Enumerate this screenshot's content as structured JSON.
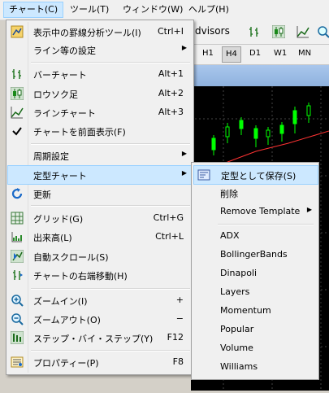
{
  "menubar": {
    "items": [
      {
        "label": "チャート(C)"
      },
      {
        "label": "ツール(T)"
      },
      {
        "label": "ウィンドウ(W)"
      },
      {
        "label": "ヘルプ(H)"
      }
    ]
  },
  "background": {
    "toolbar_text": "dvisors",
    "periods": [
      "H1",
      "H4",
      "D1",
      "W1",
      "MN"
    ]
  },
  "menu": {
    "items": [
      {
        "label": "表示中の罫線分析ツール(I)",
        "shortcut": "Ctrl+I",
        "icon": "objects-list-icon"
      },
      {
        "label": "ライン等の設定",
        "arrow": "▶"
      },
      {
        "label": "バーチャート",
        "shortcut": "Alt+1",
        "icon": "bar-chart-icon"
      },
      {
        "label": "ロウソク足",
        "shortcut": "Alt+2",
        "icon": "candlestick-icon"
      },
      {
        "label": "ラインチャート",
        "shortcut": "Alt+3",
        "icon": "line-chart-icon"
      },
      {
        "label": "チャートを前面表示(F)",
        "icon": "checkmark-icon"
      },
      {
        "label": "周期設定",
        "arrow": "▶"
      },
      {
        "label": "定型チャート",
        "arrow": "▶"
      },
      {
        "label": "更新",
        "icon": "refresh-icon"
      },
      {
        "label": "グリッド(G)",
        "shortcut": "Ctrl+G",
        "icon": "grid-icon"
      },
      {
        "label": "出来高(L)",
        "shortcut": "Ctrl+L",
        "icon": "volume-icon"
      },
      {
        "label": "自動スクロール(S)",
        "icon": "auto-scroll-icon"
      },
      {
        "label": "チャートの右端移動(H)",
        "icon": "chart-shift-icon"
      },
      {
        "label": "ズームイン(I)",
        "shortcut": "+",
        "icon": "zoom-in-icon"
      },
      {
        "label": "ズームアウト(O)",
        "shortcut": "−",
        "icon": "zoom-out-icon"
      },
      {
        "label": "ステップ・バイ・ステップ(Y)",
        "shortcut": "F12",
        "icon": "step-icon"
      },
      {
        "label": "プロパティー(P)",
        "shortcut": "F8",
        "icon": "properties-icon"
      }
    ]
  },
  "submenu": {
    "items": [
      {
        "label": "定型として保存(S)"
      },
      {
        "label": "削除"
      },
      {
        "label": "Remove Template",
        "arrow": "▶"
      },
      {
        "label": "ADX"
      },
      {
        "label": "BollingerBands"
      },
      {
        "label": "Dinapoli"
      },
      {
        "label": "Layers"
      },
      {
        "label": "Momentum"
      },
      {
        "label": "Popular"
      },
      {
        "label": "Volume"
      },
      {
        "label": "Williams"
      }
    ]
  },
  "colors": {
    "highlight": "#cce8ff",
    "highlight_border": "#99d1ff",
    "chart_bg": "#000000",
    "candle": "#00ff00"
  }
}
